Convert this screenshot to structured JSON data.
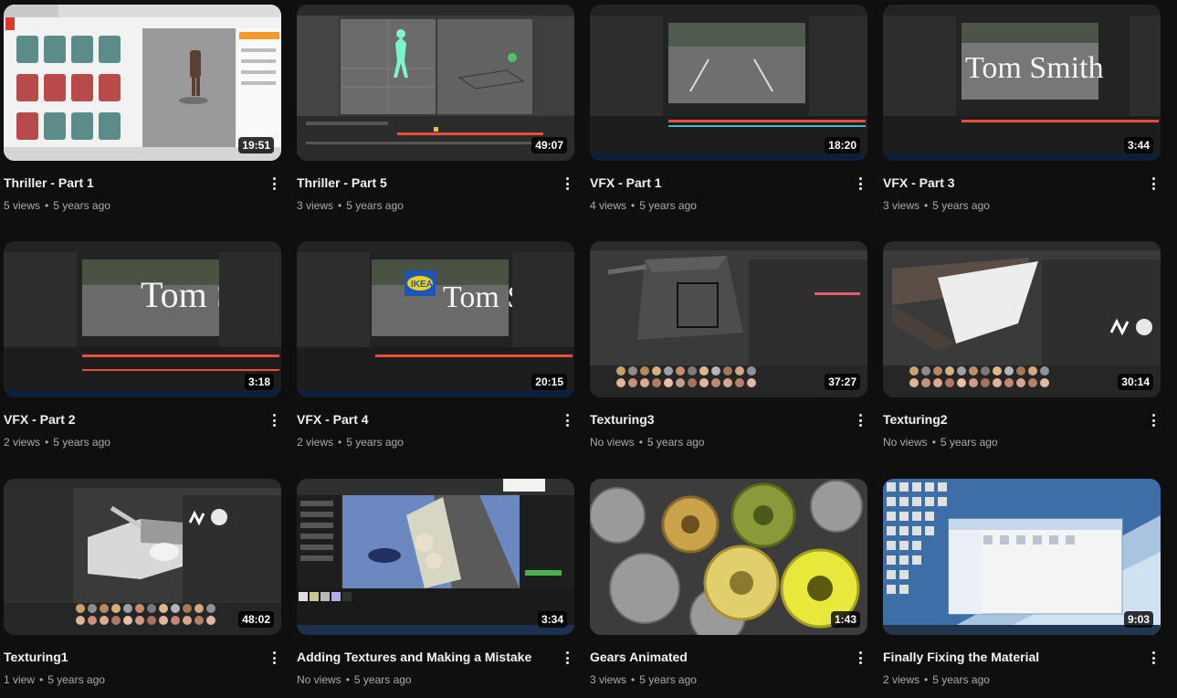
{
  "videos": [
    {
      "title": "Thriller - Part 1",
      "views": "5 views",
      "age": "5 years ago",
      "duration": "19:51",
      "thumb": "mixamo"
    },
    {
      "title": "Thriller - Part 5",
      "views": "3 views",
      "age": "5 years ago",
      "duration": "49:07",
      "thumb": "maya"
    },
    {
      "title": "VFX - Part 1",
      "views": "4 views",
      "age": "5 years ago",
      "duration": "18:20",
      "thumb": "vfx-parking"
    },
    {
      "title": "VFX - Part 3",
      "views": "3 views",
      "age": "5 years ago",
      "duration": "3:44",
      "thumb": "vfx-text"
    },
    {
      "title": "VFX - Part 2",
      "views": "2 views",
      "age": "5 years ago",
      "duration": "3:18",
      "thumb": "vfx-text2"
    },
    {
      "title": "VFX - Part 4",
      "views": "2 views",
      "age": "5 years ago",
      "duration": "20:15",
      "thumb": "vfx-ikea"
    },
    {
      "title": "Texturing3",
      "views": "No views",
      "age": "5 years ago",
      "duration": "37:27",
      "thumb": "texture-box"
    },
    {
      "title": "Texturing2",
      "views": "No views",
      "age": "5 years ago",
      "duration": "30:14",
      "thumb": "texture-wedge"
    },
    {
      "title": "Texturing1",
      "views": "1 view",
      "age": "5 years ago",
      "duration": "48:02",
      "thumb": "texture-tank"
    },
    {
      "title": "Adding Textures and Making a Mistake",
      "views": "No views",
      "age": "5 years ago",
      "duration": "3:34",
      "thumb": "unreal"
    },
    {
      "title": "Gears Animated",
      "views": "3 views",
      "age": "5 years ago",
      "duration": "1:43",
      "thumb": "gears"
    },
    {
      "title": "Finally Fixing the Material",
      "views": "2 views",
      "age": "5 years ago",
      "duration": "9:03",
      "thumb": "desktop"
    }
  ],
  "thumb_text": {
    "tom_smith": "Tom Smith",
    "ikea": "IKEA"
  },
  "separator": "•"
}
